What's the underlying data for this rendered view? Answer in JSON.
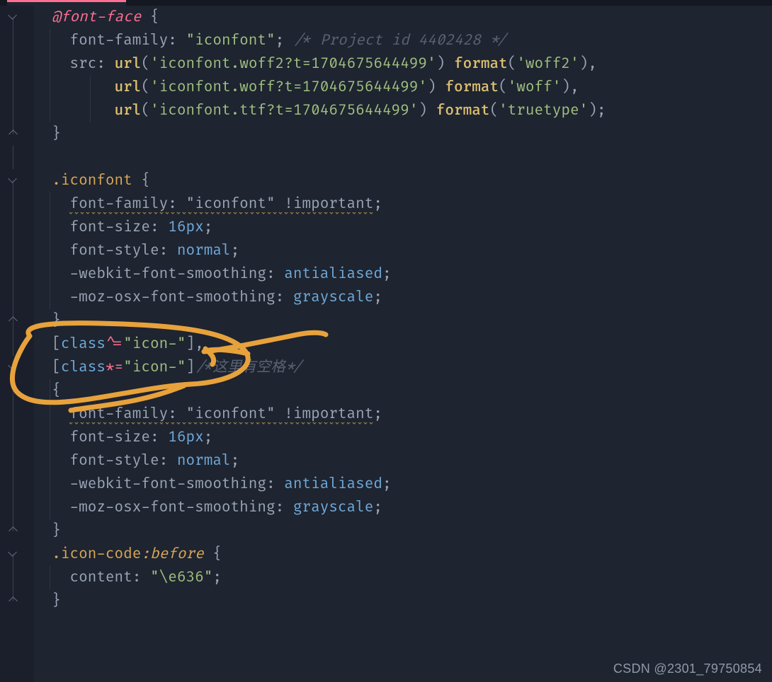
{
  "watermark": "CSDN @2301_79750854",
  "code": {
    "l1_at": "@",
    "l1_kw": "font-face",
    "l1_ob": " {",
    "l2_p": "font-family",
    "l2_c": ": ",
    "l2_v": "\"iconfont\"",
    "l2_sc": "; ",
    "l2_cmt": "/* Project id 4402428 */",
    "l3_p": "src",
    "l3_c": ": ",
    "l3_fn1": "url",
    "l3_op": "(",
    "l3_s1": "'iconfont.woff2?t=1704675644499'",
    "l3_cp": ") ",
    "l3_fn2": "format",
    "l3_op2": "(",
    "l3_s2": "'woff2'",
    "l3_end": "),",
    "l4_fn1": "url",
    "l4_op": "(",
    "l4_s1": "'iconfont.woff?t=1704675644499'",
    "l4_cp": ") ",
    "l4_fn2": "format",
    "l4_op2": "(",
    "l4_s2": "'woff'",
    "l4_end": "),",
    "l5_fn1": "url",
    "l5_op": "(",
    "l5_s1": "'iconfont.ttf?t=1704675644499'",
    "l5_cp": ") ",
    "l5_fn2": "format",
    "l5_op2": "(",
    "l5_s2": "'truetype'",
    "l5_end": ");",
    "l6": "}",
    "l8_sel": ".iconfont",
    "l8_ob": " {",
    "l9_all": "font-family: \"iconfont\" !important",
    "l9_sc": ";",
    "l10_p": "font-size",
    "l10_c": ": ",
    "l10_v": "16px",
    "l10_sc": ";",
    "l11_p": "font-style",
    "l11_c": ": ",
    "l11_v": "normal",
    "l11_sc": ";",
    "l12_p": "-webkit-font-smoothing",
    "l12_c": ": ",
    "l12_v": "antialiased",
    "l12_sc": ";",
    "l13_p": "-moz-osx-font-smoothing",
    "l13_c": ": ",
    "l13_v": "grayscale",
    "l13_sc": ";",
    "l14": "}",
    "l15_br": "[",
    "l15_attr": "class",
    "l15_op": "^=",
    "l15_v": "\"icon-\"",
    "l15_br2": "]",
    "l15_end": ",",
    "l16_br": "[",
    "l16_attr": "class",
    "l16_op": "*=",
    "l16_v": "\"icon-\"",
    "l16_br2": "]",
    "l16_cmt": "/*这里有空格*/",
    "l17": "{",
    "l18_all": "font-family: \"iconfont\" !important",
    "l18_sc": ";",
    "l19_p": "font-size",
    "l19_c": ": ",
    "l19_v": "16px",
    "l19_sc": ";",
    "l20_p": "font-style",
    "l20_c": ": ",
    "l20_v": "normal",
    "l20_sc": ";",
    "l21_p": "-webkit-font-smoothing",
    "l21_c": ": ",
    "l21_v": "antialiased",
    "l21_sc": ";",
    "l22_p": "-moz-osx-font-smoothing",
    "l22_c": ": ",
    "l22_v": "grayscale",
    "l22_sc": ";",
    "l23": "}",
    "l24_sel": ".icon-code",
    "l24_ps": ":before",
    "l24_ob": " {",
    "l25_p": "content",
    "l25_c": ": ",
    "l25_v": "\"\\e636\"",
    "l25_sc": ";",
    "l26": "}"
  }
}
